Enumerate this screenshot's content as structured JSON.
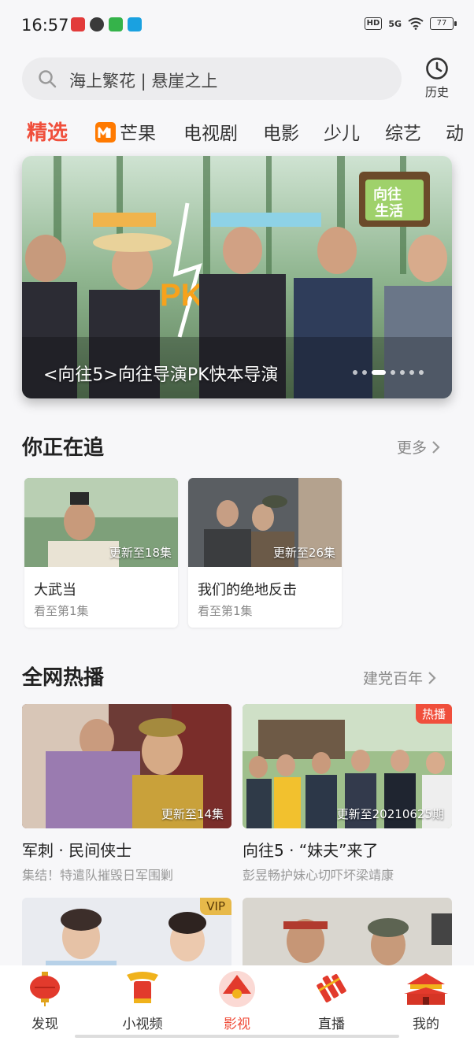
{
  "status": {
    "time": "16:57",
    "hd": "HD",
    "net": "5G",
    "battery": "77"
  },
  "search": {
    "placeholder": "海上繁花 | 悬崖之上",
    "history_label": "历史"
  },
  "tabs": [
    "精选",
    "芒果",
    "电视剧",
    "电影",
    "少儿",
    "综艺",
    "动"
  ],
  "active_tab": 0,
  "banner": {
    "caption": "<向往5>向往导演PK快本导演",
    "pages": 7,
    "current_page": 2
  },
  "continue_watching": {
    "title": "你正在追",
    "more": "更多",
    "items": [
      {
        "title": "大武当",
        "update": "更新至18集",
        "progress": "看至第1集"
      },
      {
        "title": "我们的绝地反击",
        "update": "更新至26集",
        "progress": "看至第1集"
      }
    ]
  },
  "hot": {
    "title": "全网热播",
    "more": "建党百年",
    "items": [
      {
        "title": "军刺 · 民间侠士",
        "subtitle": "集结！特遣队摧毁日军围剿",
        "update": "更新至14集",
        "badge": ""
      },
      {
        "title": "向往5 · “妹夫”来了",
        "subtitle": "彭昱畅护妹心切吓坏梁靖康",
        "update": "更新至20210625期",
        "badge": "热播"
      },
      {
        "title": "",
        "subtitle": "",
        "update": "",
        "badge": "VIP"
      },
      {
        "title": "",
        "subtitle": "",
        "update": "",
        "badge": ""
      }
    ]
  },
  "nav": {
    "items": [
      {
        "label": "发现",
        "icon": "lantern-icon"
      },
      {
        "label": "小视频",
        "icon": "drum-icon"
      },
      {
        "label": "影视",
        "icon": "fan-icon"
      },
      {
        "label": "直播",
        "icon": "firecracker-icon"
      },
      {
        "label": "我的",
        "icon": "tiananmen-icon"
      }
    ],
    "active": 2
  },
  "colors": {
    "accent": "#f04f3c",
    "mango": "#ff7a00"
  }
}
